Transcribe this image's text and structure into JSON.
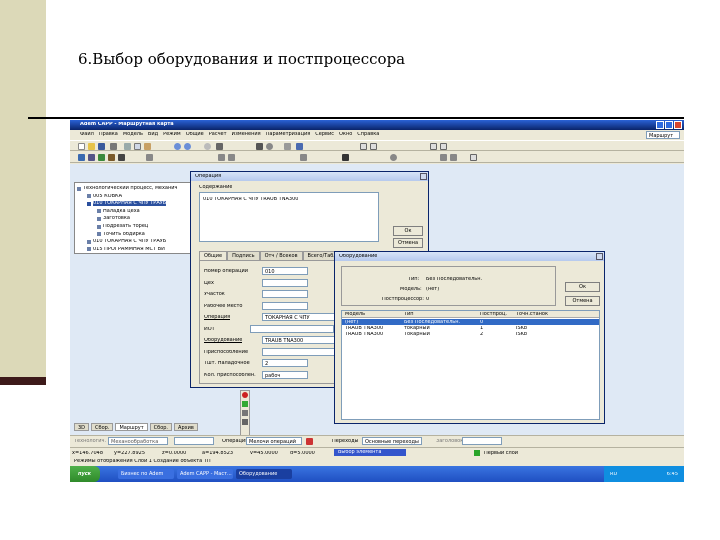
{
  "slide": {
    "title": "6.Выбор оборудования и постпроцессора",
    "colors": {
      "accent_bar": "#dcd9b8",
      "dark_bar": "#3d1a1a",
      "title_bar": "#0a246a",
      "desktop": "#dfe9f5"
    }
  },
  "app": {
    "title": "Adem CAPP - Маршрутная карта",
    "menu": [
      "Файл",
      "Правка",
      "Модель",
      "Вид",
      "Режим",
      "Общие",
      "Расчет",
      "Изменения",
      "Параметризация",
      "Сервис",
      "Окно",
      "Справка"
    ],
    "combo": "Маршрут"
  },
  "tree": {
    "items": [
      {
        "label": "Технологический процесс, механич"
      },
      {
        "label": "005 КОВКА"
      },
      {
        "label": "010 ТОКАРНАЯ С ЧПУ ТРАУБ"
      },
      {
        "label": "Наладка цеха"
      },
      {
        "label": "Заготовка"
      },
      {
        "label": "Подрезать торец"
      },
      {
        "label": "Точить обдирка"
      },
      {
        "label": "010 ТОКАРНАЯ С ЧПУ ТРАУБ"
      },
      {
        "label": "015 ПРОГРАММНАЯ МСТ ВИ"
      }
    ]
  },
  "op_dialog": {
    "title": "Операция",
    "section_label": "Содержание",
    "list_text": "010 ТОКАРНАЯ С ЧПУ TRAUB TNA300",
    "ok": "Ок",
    "cancel": "Отмена",
    "tabs": [
      "Общие",
      "Подпись",
      "Отч / Всеков",
      "Всего/Таблица"
    ],
    "fields": [
      {
        "label": "Номер операции",
        "value": "010"
      },
      {
        "label": "Цех",
        "value": ""
      },
      {
        "label": "Участок",
        "value": ""
      },
      {
        "label": "Рабочее место",
        "value": ""
      },
      {
        "label": "Операция",
        "value": "ТОКАРНАЯ С ЧПУ"
      },
      {
        "label": "ИОТ",
        "value": ""
      },
      {
        "label": "Оборудование",
        "value": "TRAUB TNA300"
      },
      {
        "label": "Приспособление",
        "value": ""
      },
      {
        "label": "Тшт. Наладочное",
        "value": "2"
      },
      {
        "label": "Кол. приспособлен.",
        "value": "рабоч"
      }
    ]
  },
  "equip_dialog": {
    "title": "Оборудование",
    "type_label": "Тип:",
    "type_value": "Без Последовательн.",
    "model_label": "Модель:",
    "model_value": "(нет)",
    "post_label": "Постпроцессор:",
    "post_value": "0",
    "ok": "Ок",
    "cancel": "Отмена",
    "columns": [
      "Модель",
      "Тип",
      "Постпроц.",
      "Точн.станок"
    ],
    "rows": [
      {
        "model": "(нет)",
        "type": "Без Последовательн.",
        "post": "0",
        "kind": "",
        "selected": true
      },
      {
        "model": "TRAUB TNA300",
        "type": "токарный",
        "post": "1",
        "kind": "ISKb",
        "selected": false
      },
      {
        "model": "TRAUB TNA300",
        "type": "Токарный",
        "post": "2",
        "kind": "ISKb",
        "selected": false
      }
    ]
  },
  "bottom_tabs": [
    "3D",
    "Сбор.",
    "Маршрут",
    "Сбор.",
    "Архив"
  ],
  "bottom_bar": {
    "labels": [
      "Технологич.",
      "Операция",
      "Переходы",
      "Заголовок"
    ],
    "values": [
      "Механообработка",
      "Мелочи операций",
      "Основные переходы"
    ]
  },
  "status_bar": {
    "coords": [
      "x=146.7048",
      "y=227.8925",
      "z=0.0000",
      "a=194.8523",
      "v=45.0000",
      "d=5.0000"
    ],
    "badge": "Выбор элемента",
    "right": "Первый слой",
    "mode": "Режимы отображения  Слой 1  Создание объекта ТП"
  },
  "taskbar": {
    "start": "пуск",
    "items": [
      "Бизнес по Adem",
      "Adem CAPP - Маст...",
      "Оборудование"
    ],
    "lang": "RU",
    "time": "6:45"
  }
}
